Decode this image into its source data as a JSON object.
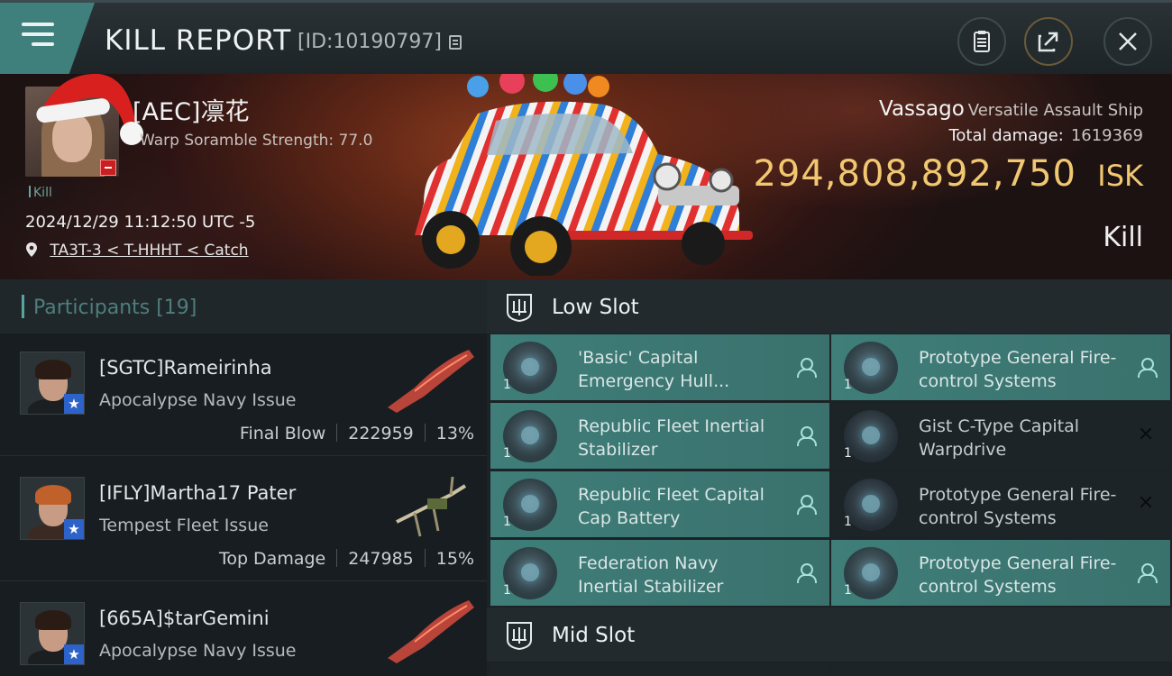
{
  "header": {
    "title": "KILL REPORT",
    "report_id": "[ID:10190797]"
  },
  "victim": {
    "name": "[AEC]凛花",
    "warp_scramble": "Warp Soramble Strength: 77.0",
    "tag": "Kill",
    "datetime": "2024/12/29 11:12:50 UTC -5",
    "location": "TA3T-3 < T-HHHT < Catch",
    "ship_name": "Vassago",
    "ship_class": "Versatile Assault Ship",
    "total_damage_label": "Total damage:",
    "total_damage_value": "1619369",
    "isk_value": "294,808,892,750",
    "isk_unit": "ISK",
    "result": "Kill"
  },
  "participants": {
    "title": "Participants [19]",
    "rows": [
      {
        "name": "[SGTC]Rameirinha",
        "ship": "Apocalypse Navy Issue",
        "role": "Final Blow",
        "damage": "222959",
        "percent": "13%"
      },
      {
        "name": "[IFLY]Martha17 Pater",
        "ship": "Tempest Fleet Issue",
        "role": "Top Damage",
        "damage": "247985",
        "percent": "15%"
      },
      {
        "name": "[665A]$tarGemini",
        "ship": "Apocalypse Navy Issue",
        "role": "",
        "damage": "",
        "percent": ""
      }
    ]
  },
  "low_slot": {
    "title": "Low Slot",
    "modules": [
      {
        "name": "'Basic' Capital Emergency Hull...",
        "qty": "1",
        "status": "person"
      },
      {
        "name": "Prototype General Fire-control Systems",
        "qty": "1",
        "status": "person"
      },
      {
        "name": "Republic Fleet Inertial Stabilizer",
        "qty": "1",
        "status": "person"
      },
      {
        "name": "Gist C-Type Capital Warpdrive",
        "qty": "1",
        "status": "x"
      },
      {
        "name": "Republic Fleet Capital Cap Battery",
        "qty": "1",
        "status": "person"
      },
      {
        "name": "Prototype General Fire-control Systems",
        "qty": "1",
        "status": "x"
      },
      {
        "name": "Federation Navy Inertial Stabilizer",
        "qty": "1",
        "status": "person"
      },
      {
        "name": "Prototype General Fire-control Systems",
        "qty": "1",
        "status": "person"
      }
    ]
  },
  "mid_slot": {
    "title": "Mid Slot"
  },
  "colors": {
    "accent_teal": "#3f7e79",
    "isk_gold": "#f1c871",
    "badge_blue": "#2d62c8",
    "badge_red": "#c82020"
  },
  "icons": [
    "menu-icon",
    "copy-icon",
    "clipboard-icon",
    "share-icon",
    "close-icon",
    "santa-hat-icon",
    "location-pin-icon",
    "star-icon",
    "low-slot-icon",
    "mid-slot-icon",
    "person-icon",
    "x-icon"
  ]
}
